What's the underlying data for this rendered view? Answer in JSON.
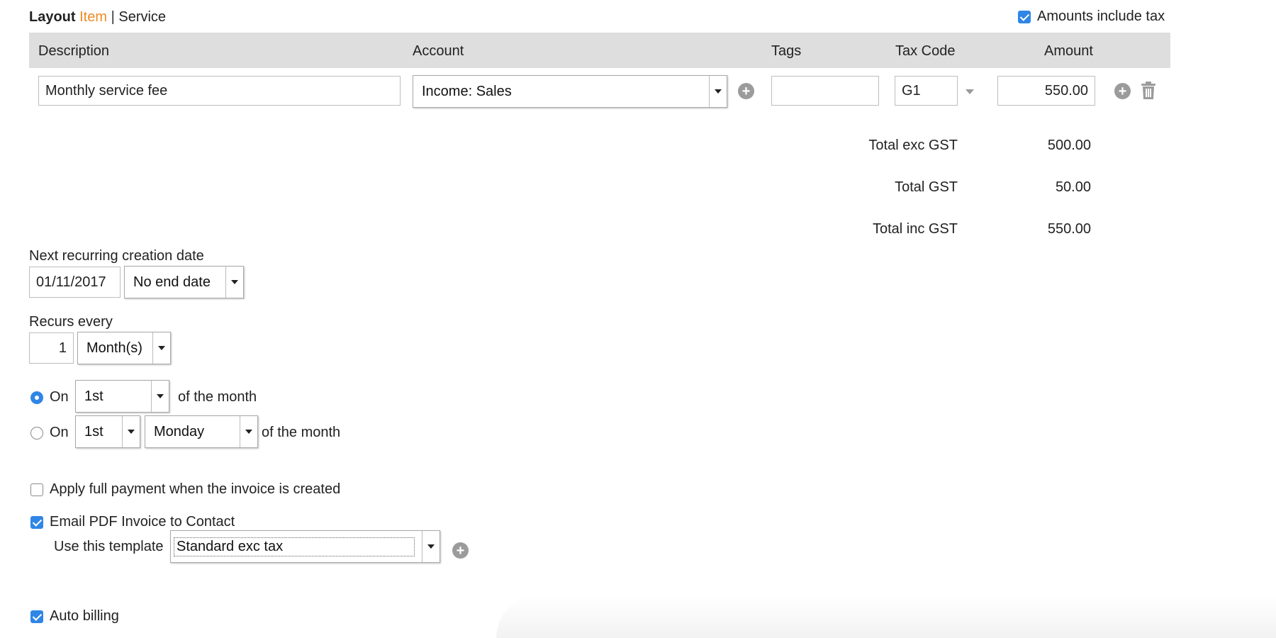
{
  "header": {
    "layout_label": "Layout",
    "layout_item": "Item",
    "separator": "|",
    "layout_service": "Service",
    "amounts_include_tax_label": "Amounts include tax",
    "amounts_include_tax_checked": true
  },
  "table": {
    "columns": [
      "Description",
      "Account",
      "Tags",
      "Tax Code",
      "Amount"
    ],
    "row": {
      "description": "Monthly service fee",
      "account": "Income: Sales",
      "tags": "",
      "tax_code": "G1",
      "amount": "550.00"
    }
  },
  "totals": {
    "exc_label": "Total exc GST",
    "exc_value": "500.00",
    "gst_label": "Total GST",
    "gst_value": "50.00",
    "inc_label": "Total inc GST",
    "inc_value": "550.00"
  },
  "recurring": {
    "next_date_label": "Next recurring creation date",
    "next_date": "01/11/2017",
    "end_option": "No end date",
    "recurs_every_label": "Recurs every",
    "interval": "1",
    "interval_unit": "Month(s)",
    "option1": {
      "label": "On",
      "day": "1st",
      "suffix": "of the month",
      "selected": true
    },
    "option2": {
      "label": "On",
      "ordinal": "1st",
      "weekday": "Monday",
      "suffix": "of the month",
      "selected": false
    }
  },
  "options": {
    "apply_full_payment_label": "Apply full payment when the invoice is created",
    "apply_full_payment_checked": false,
    "email_pdf_label": "Email PDF Invoice to Contact",
    "email_pdf_checked": true,
    "template_label": "Use this template",
    "template_value": "Standard exc tax",
    "auto_billing_label": "Auto billing",
    "auto_billing_checked": true
  },
  "colors": {
    "accent": "#2f86e6",
    "item_link": "#f08a24",
    "header_bg": "#dedede"
  }
}
